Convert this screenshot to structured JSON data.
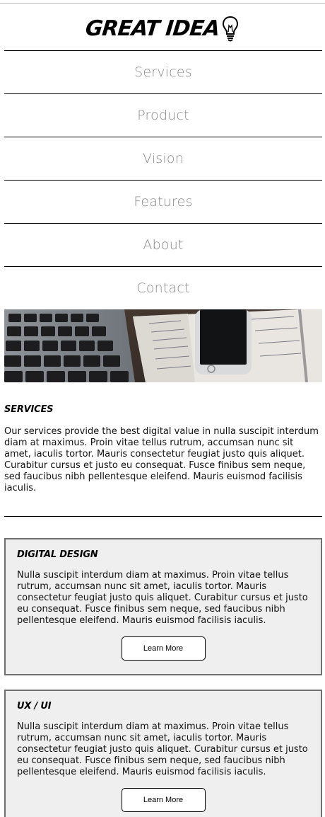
{
  "header": {
    "logo_text": "GREAT IDEA",
    "logo_icon": "lightbulb-icon"
  },
  "nav": {
    "items": [
      {
        "label": "Services"
      },
      {
        "label": "Product"
      },
      {
        "label": "Vision"
      },
      {
        "label": "Features"
      },
      {
        "label": "About"
      },
      {
        "label": "Contact"
      }
    ]
  },
  "hero": {
    "image": "laptop-phone-notebook-photo"
  },
  "services": {
    "title": "SERVICES",
    "text": "Our services provide the best digital value in nulla suscipit interdum diam at maximus. Proin vitae tellus rutrum, accumsan nunc sit amet, iaculis tortor. Mauris consectetur feugiat justo quis aliquet. Curabitur cursus et justo eu consequat. Fusce finibus sem neque, sed faucibus nibh pellentesque eleifend. Mauris euismod facilisis iaculis."
  },
  "cards": [
    {
      "title": "DIGITAL DESIGN",
      "text": "Nulla suscipit interdum diam at maximus. Proin vitae tellus rutrum, accumsan nunc sit amet, iaculis tortor. Mauris consectetur feugiat justo quis aliquet. Curabitur cursus et justo eu consequat. Fusce finibus sem neque, sed faucibus nibh pellentesque eleifend. Mauris euismod facilisis iaculis.",
      "button": "Learn More"
    },
    {
      "title": "UX / UI",
      "text": "Nulla suscipit interdum diam at maximus. Proin vitae tellus rutrum, accumsan nunc sit amet, iaculis tortor. Mauris consectetur feugiat justo quis aliquet. Curabitur cursus et justo eu consequat. Fusce finibus sem neque, sed faucibus nibh pellentesque eleifend. Mauris euismod facilisis iaculis.",
      "button": "Learn More"
    }
  ],
  "colors": {
    "nav_text": "#8a8a8a",
    "card_bg": "#efefef",
    "card_border": "#6f6f6f"
  }
}
